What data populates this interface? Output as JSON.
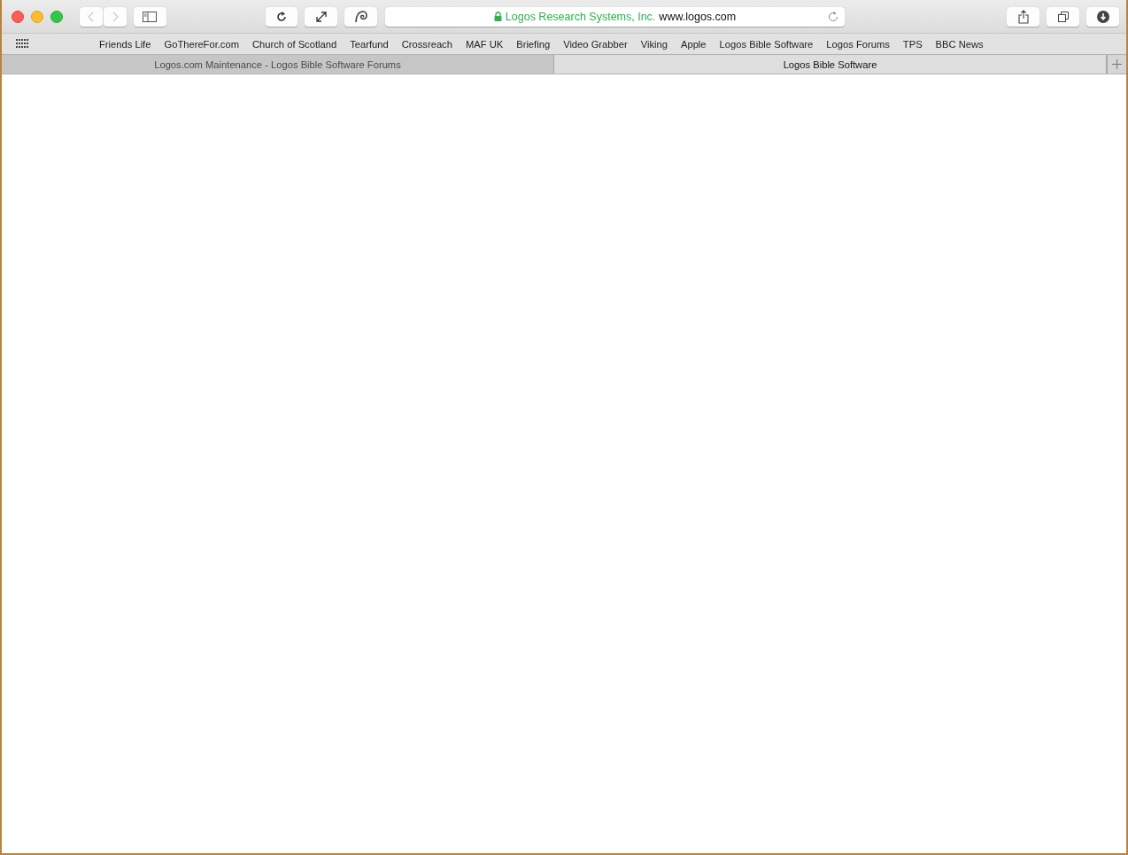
{
  "address_bar": {
    "secure": true,
    "identity": "Logos Research Systems, Inc.",
    "url": "www.logos.com"
  },
  "navigation": {
    "back_disabled": true,
    "forward_disabled": true
  },
  "bookmarks": [
    "Friends Life",
    "GoThereFor.com",
    "Church of Scotland",
    "Tearfund",
    "Crossreach",
    "MAF UK",
    "Briefing",
    "Video Grabber",
    "Viking",
    "Apple",
    "Logos Bible Software",
    "Logos Forums",
    "TPS",
    "BBC News"
  ],
  "tabs": [
    {
      "title": "Logos.com Maintenance - Logos Bible Software Forums",
      "selected": false
    },
    {
      "title": "Logos Bible Software",
      "selected": true
    }
  ]
}
